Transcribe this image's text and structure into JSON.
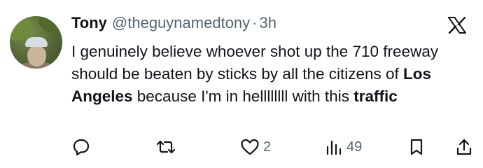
{
  "tweet": {
    "author_name": "Tony",
    "handle": "@theguynamedtony",
    "separator": "·",
    "time": "3h",
    "text_parts": {
      "p1": "I genuinely believe whoever shot up the 710 freeway should be beaten by sticks by all the citizens of ",
      "b1": "Los Angeles",
      "p2": " because I'm in hellllllll with this ",
      "b2": "traffic"
    }
  },
  "actions": {
    "reply_icon": "reply-icon",
    "retweet_icon": "retweet-icon",
    "like_icon": "heart-icon",
    "like_count": "2",
    "views_icon": "views-icon",
    "views_count": "49",
    "bookmark_icon": "bookmark-icon",
    "share_icon": "share-icon"
  },
  "logo": "x-logo-icon",
  "colors": {
    "text": "#0f1419",
    "muted": "#536471",
    "background": "#ffffff"
  }
}
